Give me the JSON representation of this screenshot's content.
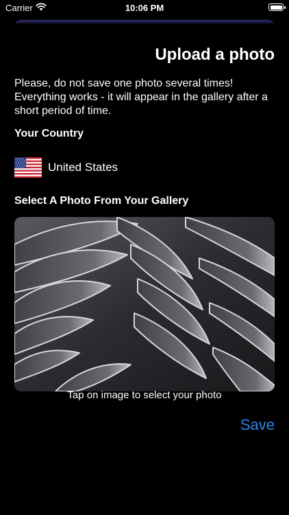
{
  "status_bar": {
    "carrier": "Carrier",
    "time": "10:06 PM",
    "wifi_icon": "wifi-icon",
    "battery_icon": "battery-full-icon"
  },
  "header": {
    "title": "Upload a photo"
  },
  "notice": {
    "text": "Please, do not save one photo several times! Everything works - it will appear in the gallery after a short period of time."
  },
  "country": {
    "label": "Your Country",
    "flag_icon": "us-flag-icon",
    "name": "United States"
  },
  "gallery": {
    "label": "Select A Photo From Your Gallery",
    "hint": "Tap on image to select your photo"
  },
  "actions": {
    "save_label": "Save"
  },
  "colors": {
    "background": "#000000",
    "text": "#ffffff",
    "accent": "#2b82e8",
    "sheet": "#1b1a44"
  }
}
